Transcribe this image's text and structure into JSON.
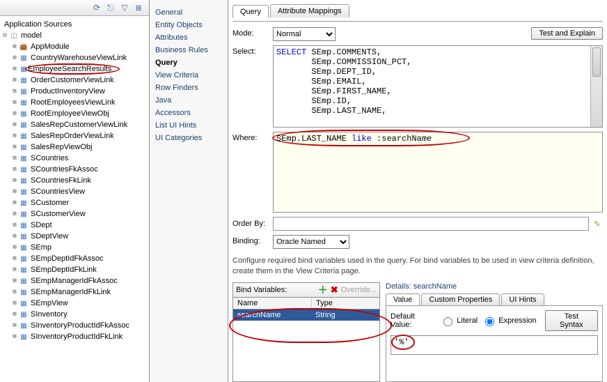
{
  "tree": {
    "title": "Application Sources",
    "root": "model",
    "items": [
      "AppModule",
      "CountryWarehouseViewLink",
      "EmployeeSearchResults",
      "OrderCustomerViewLink",
      "ProductInventoryView",
      "RootEmployeesViewLink",
      "RootEmployeeViewObj",
      "SalesRepCustomerViewLink",
      "SalesRepOrderViewLink",
      "SalesRepViewObj",
      "SCountries",
      "SCountriesFkAssoc",
      "SCountriesFkLink",
      "SCountriesView",
      "SCustomer",
      "SCustomerView",
      "SDept",
      "SDeptView",
      "SEmp",
      "SEmpDeptIdFkAssoc",
      "SEmpDeptIdFkLink",
      "SEmpManagerIdFkAssoc",
      "SEmpManagerIdFkLink",
      "SEmpView",
      "SInventory",
      "SInventoryProductIdFkAssoc",
      "SInventoryProductIdFkLink"
    ],
    "highlighted_index": 2
  },
  "nav": {
    "items": [
      "General",
      "Entity Objects",
      "Attributes",
      "Business Rules",
      "Query",
      "View Criteria",
      "Row Finders",
      "Java",
      "Accessors",
      "List UI Hints",
      "UI Categories"
    ],
    "selected_index": 4
  },
  "tabs": {
    "items": [
      "Query",
      "Attribute Mappings"
    ],
    "selected_index": 0
  },
  "mode": {
    "label": "Mode:",
    "value": "Normal",
    "button": "Test and Explain"
  },
  "select": {
    "label": "Select:",
    "keyword": "SELECT",
    "lines": [
      "SEmp.COMMENTS,",
      "SEmp.COMMISSION_PCT,",
      "SEmp.DEPT_ID,",
      "SEmp.EMAIL,",
      "SEmp.FIRST_NAME,",
      "SEmp.ID,",
      "SEmp.LAST_NAME,"
    ]
  },
  "where": {
    "label": "Where:",
    "left": "SEmp.LAST_NAME ",
    "kw": "like",
    "right": " :searchName"
  },
  "orderby": {
    "label": "Order By:",
    "value": ""
  },
  "binding": {
    "label": "Binding:",
    "value": "Oracle Named"
  },
  "note": "Configure required bind variables used in the query.  For bind variables to be used in view criteria definition, create them in the View Criteria page.",
  "bindvars": {
    "title": "Bind Variables:",
    "override": "Override...",
    "cols": [
      "Name",
      "Type"
    ],
    "row": {
      "name": "searchName",
      "type": "String"
    }
  },
  "details": {
    "title_prefix": "Details:",
    "title_name": "searchName",
    "tabs": [
      "Value",
      "Custom Properties",
      "UI Hints"
    ],
    "selected_tab": 0,
    "default_label": "Default Value:",
    "literal": "Literal",
    "expression": "Expression",
    "test_btn": "Test Syntax",
    "expr_value": "'%'"
  }
}
